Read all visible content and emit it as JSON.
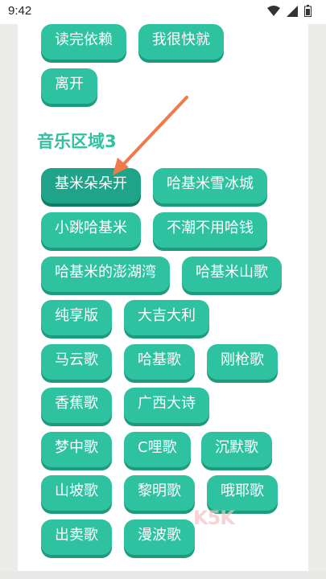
{
  "status": {
    "time": "9:42"
  },
  "section": {
    "title": "音乐区域3"
  },
  "top_chips": [
    "读完依赖",
    "我很快就",
    "离开"
  ],
  "chips": [
    "基米朵朵开",
    "哈基米雪冰城",
    "小跳哈基米",
    "不潮不用哈钱",
    "哈基米的澎湖湾",
    "哈基米山歌",
    "纯享版",
    "大吉大利",
    "马云歌",
    "哈基歌",
    "刚枪歌",
    "香蕉歌",
    "广西大诗",
    "梦中歌",
    "C哩歌",
    "沉默歌",
    "山坡歌",
    "黎明歌",
    "哦耶歌",
    "出卖歌",
    "漫波歌"
  ],
  "selected": "基米朵朵开",
  "watermark": "K5K",
  "colors": {
    "accent": "#2ec2a0",
    "selected": "#1fa489",
    "arrow": "#f07a4a"
  }
}
